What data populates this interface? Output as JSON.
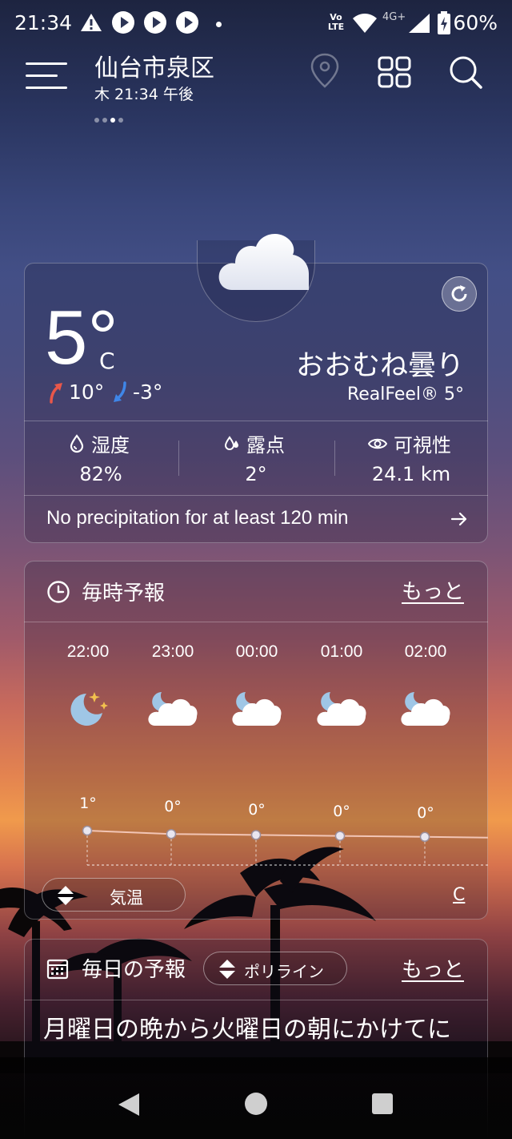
{
  "status_bar": {
    "time": "21:34",
    "network_label": "4G+",
    "volte_label": "Vo LTE",
    "battery": "60%"
  },
  "header": {
    "location": "仙台市泉区",
    "datetime": "木 21:34 午後",
    "page_count": 4,
    "active_page": 2
  },
  "current": {
    "temperature": "5°",
    "unit": "C",
    "high": "10°",
    "low": "-3°",
    "condition": "おおむね曇り",
    "realfeel_label": "RealFeel®",
    "realfeel_value": "5°",
    "stats": [
      {
        "label": "湿度",
        "value": "82%",
        "icon": "humidity-drop-icon"
      },
      {
        "label": "露点",
        "value": "2°",
        "icon": "dew-point-icon"
      },
      {
        "label": "可視性",
        "value": "24.1 km",
        "icon": "eye-icon"
      }
    ],
    "precipitation": "No precipitation for at least 120 min"
  },
  "hourly": {
    "title": "毎時予報",
    "more": "もっと",
    "hours": [
      {
        "time": "22:00",
        "temp": "1°",
        "icon": "moon-stars-icon",
        "value": 1
      },
      {
        "time": "23:00",
        "temp": "0°",
        "icon": "cloudy-night-icon",
        "value": 0
      },
      {
        "time": "00:00",
        "temp": "0°",
        "icon": "cloudy-night-icon",
        "value": 0
      },
      {
        "time": "01:00",
        "temp": "0°",
        "icon": "cloudy-night-icon",
        "value": 0
      },
      {
        "time": "02:00",
        "temp": "0°",
        "icon": "cloudy-night-icon",
        "value": 0
      }
    ],
    "selector_label": "気温",
    "unit_link": "C"
  },
  "daily": {
    "title": "毎日の予報",
    "selector_label": "ポリライン",
    "more": "もっと",
    "summary": "月曜日の晩から火曜日の朝にかけてに"
  },
  "colors": {
    "high_arrow": "#e8574a",
    "low_arrow": "#3f86e8",
    "moon": "#9fc6e6",
    "cloud": "#ffffff"
  }
}
